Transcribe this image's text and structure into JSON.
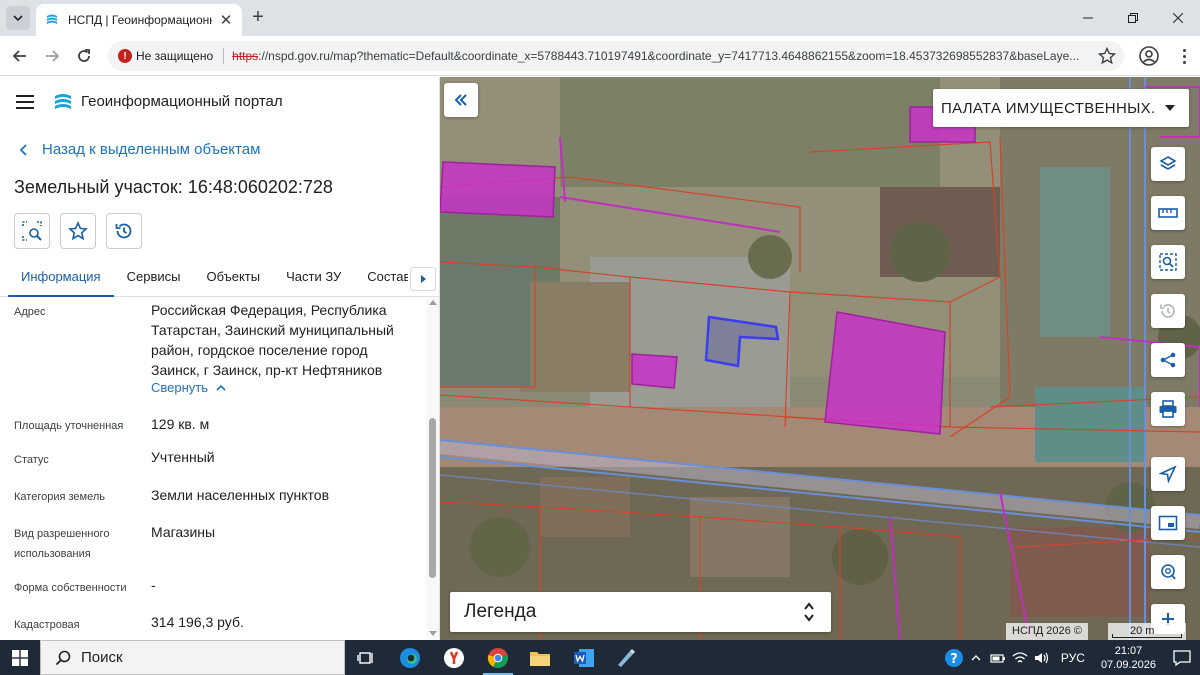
{
  "browser": {
    "tab_title": "НСПД | Геоинформационный",
    "insecure_label": "Не защищено",
    "url_scheme": "https",
    "url_rest": "://nspd.gov.ru/map?thematic=Default&coordinate_x=5788443.710197491&coordinate_y=7417713.4648862155&zoom=18.453732698552837&baseLaye..."
  },
  "app": {
    "title": "Геоинформационный портал",
    "back_label": "Назад к выделенным объектам",
    "object_title": "Земельный участок: 16:48:060202:728"
  },
  "tabs": [
    {
      "label": "Информация",
      "active": true
    },
    {
      "label": "Сервисы"
    },
    {
      "label": "Объекты"
    },
    {
      "label": "Части ЗУ"
    },
    {
      "label": "Состав"
    }
  ],
  "properties": {
    "address": {
      "label": "Адрес",
      "lines": [
        "Российская Федерация, Республика",
        "Татарстан, Заинский муниципальный",
        "район, гордское поселение город",
        "Заинск, г Заинск, пр-кт Нефтяников"
      ],
      "collapse_label": "Свернуть"
    },
    "area": {
      "label": "Площадь уточненная",
      "value": "129 кв. м"
    },
    "status": {
      "label": "Статус",
      "value": "Учтенный"
    },
    "category": {
      "label": "Категория земель",
      "value": "Земли населенных пунктов"
    },
    "permitted_use": {
      "label_lines": [
        "Вид разрешенного",
        "использования"
      ],
      "value": "Магазины"
    },
    "ownership": {
      "label": "Форма собственности",
      "value": "-"
    },
    "cadastral": {
      "label": "Кадастровая",
      "value": "314 196,3 руб."
    }
  },
  "map": {
    "layer_select": "ПАЛАТА ИМУЩЕСТВЕННЫХ...",
    "legend_label": "Легенда",
    "copyright": "НСПД 2026 ©",
    "scale": "20 m",
    "tools": [
      "layers-icon",
      "ruler-icon",
      "select-area-icon",
      "history-icon",
      "share-icon",
      "print-icon",
      "locate-icon",
      "minimap-icon",
      "search-place-icon",
      "zoom-in-icon"
    ],
    "colors": {
      "parcel_border": "#d2452a",
      "highlight_fill": "#c832c8",
      "selected_border": "#3c3cf0",
      "road_border": "#6a8fd6"
    }
  },
  "taskbar": {
    "search_label": "Поиск",
    "lang": "РУС",
    "time": "21:07",
    "date": "07.09.2026"
  }
}
